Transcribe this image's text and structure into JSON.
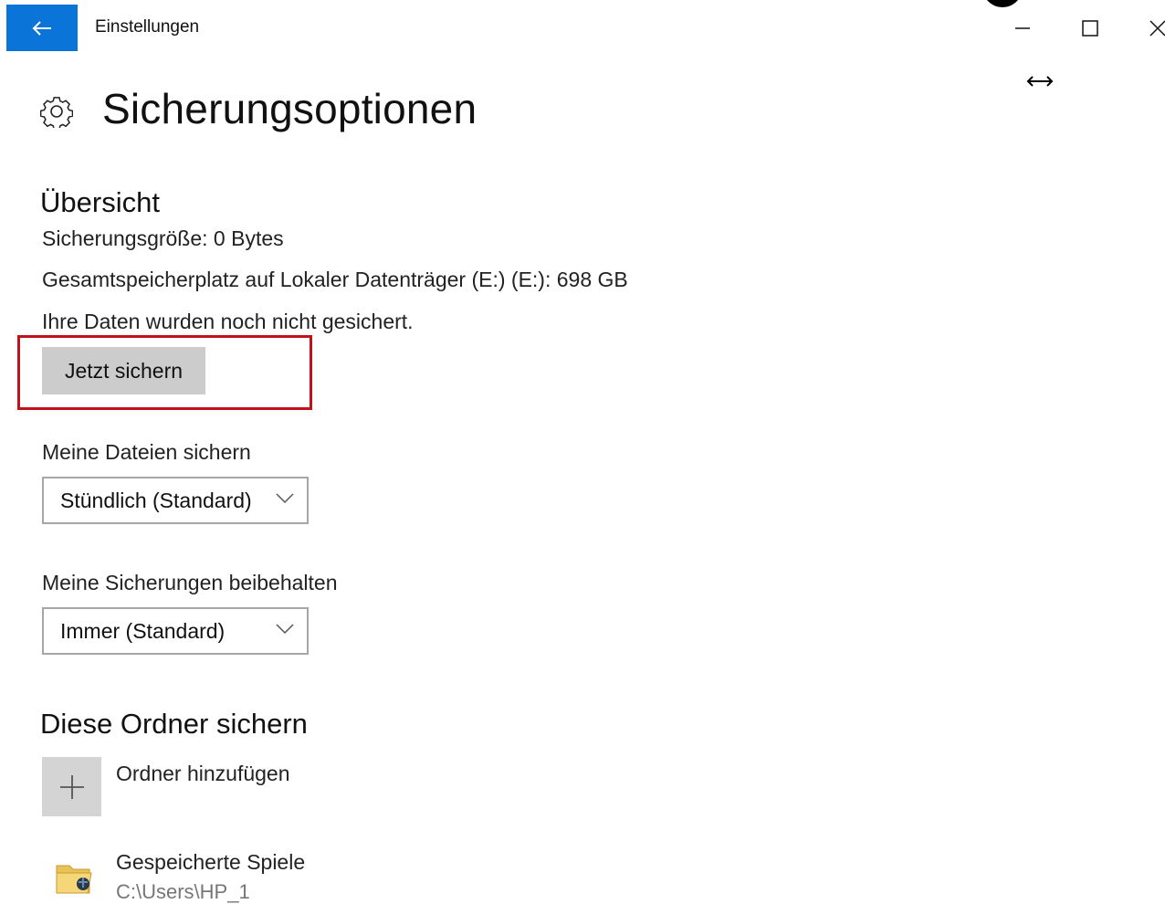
{
  "titlebar": {
    "app_title": "Einstellungen"
  },
  "page": {
    "title": "Sicherungsoptionen"
  },
  "overview": {
    "heading": "Übersicht",
    "backup_size": "Sicherungsgröße: 0 Bytes",
    "total_space": "Gesamtspeicherplatz auf Lokaler Datenträger (E:) (E:): 698 GB",
    "status": "Ihre Daten wurden noch nicht gesichert.",
    "backup_now_label": "Jetzt sichern"
  },
  "backup_frequency": {
    "label": "Meine Dateien sichern",
    "value": "Stündlich (Standard)"
  },
  "retention": {
    "label": "Meine Sicherungen beibehalten",
    "value": "Immer (Standard)"
  },
  "folders": {
    "heading": "Diese Ordner sichern",
    "add_label": "Ordner hinzufügen",
    "items": [
      {
        "name": "Gespeicherte Spiele",
        "path": "C:\\Users\\HP_1"
      }
    ]
  },
  "colors": {
    "accent": "#0b74d8",
    "highlight": "#c0121a",
    "button": "#cccccc"
  },
  "icons": [
    "back-arrow-icon",
    "minimize-icon",
    "maximize-icon",
    "close-icon",
    "gear-icon",
    "chevron-down-icon",
    "plus-icon",
    "folder-icon",
    "resize-cursor-icon"
  ]
}
